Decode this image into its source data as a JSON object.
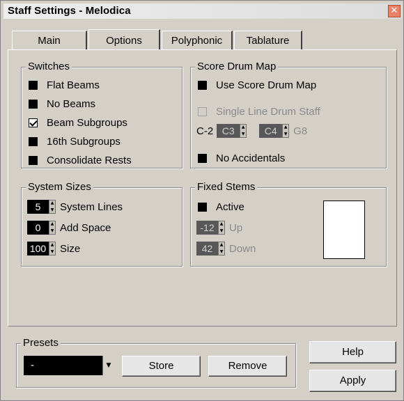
{
  "window": {
    "title": "Staff Settings - Melodica",
    "close_glyph": "✕"
  },
  "tabs": [
    {
      "label": "Main"
    },
    {
      "label": "Options"
    },
    {
      "label": "Polyphonic"
    },
    {
      "label": "Tablature"
    }
  ],
  "switches": {
    "title": "Switches",
    "items": [
      {
        "label": "Flat Beams",
        "checked": false
      },
      {
        "label": "No Beams",
        "checked": false
      },
      {
        "label": "Beam Subgroups",
        "checked": true
      },
      {
        "label": "16th Subgroups",
        "checked": false
      },
      {
        "label": "Consolidate Rests",
        "checked": false
      }
    ]
  },
  "score_drum_map": {
    "title": "Score Drum Map",
    "use_label": "Use Score Drum Map",
    "single_line_label": "Single Line Drum Staff",
    "range_low_label": "C-2",
    "range_from": "C3",
    "range_to": "C4",
    "range_high_label": "G8",
    "no_accidentals_label": "No Accidentals"
  },
  "system_sizes": {
    "title": "System Sizes",
    "system_lines_value": "5",
    "system_lines_label": "System Lines",
    "add_space_value": "0",
    "add_space_label": "Add Space",
    "size_value": "100",
    "size_label": "Size"
  },
  "fixed_stems": {
    "title": "Fixed Stems",
    "active_label": "Active",
    "up_value": "-12",
    "up_label": "Up",
    "down_value": "42",
    "down_label": "Down"
  },
  "presets": {
    "title": "Presets",
    "selected": "-",
    "store_label": "Store",
    "remove_label": "Remove"
  },
  "buttons": {
    "help_label": "Help",
    "apply_label": "Apply"
  },
  "icons": {
    "arrow_up": "▲",
    "arrow_down": "▼"
  }
}
